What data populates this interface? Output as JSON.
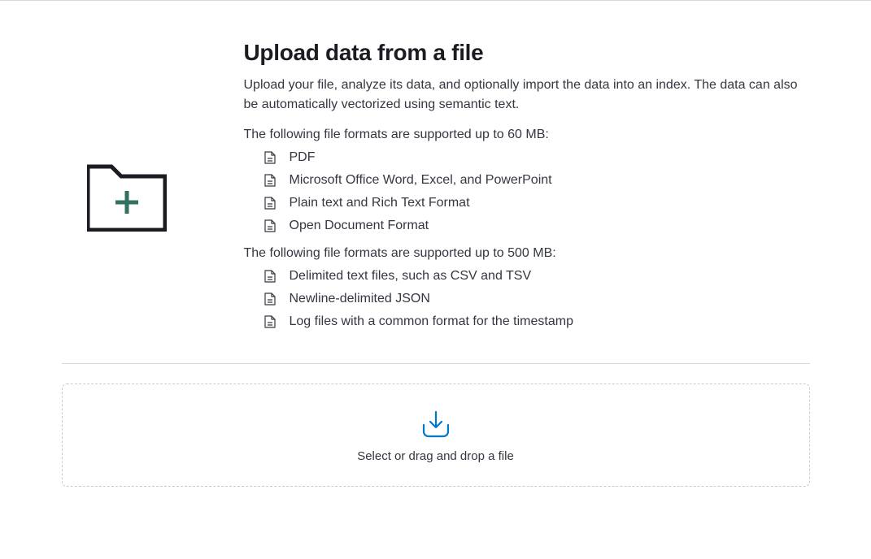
{
  "page": {
    "title": "Upload data from a file",
    "description": "Upload your file, analyze its data, and optionally import the data into an index. The data can also be automatically vectorized using semantic text."
  },
  "sections": {
    "small": {
      "intro": "The following file formats are supported up to 60 MB:",
      "items": [
        "PDF",
        "Microsoft Office Word, Excel, and PowerPoint",
        "Plain text and Rich Text Format",
        "Open Document Format"
      ]
    },
    "large": {
      "intro": "The following file formats are supported up to 500 MB:",
      "items": [
        "Delimited text files, such as CSV and TSV",
        "Newline-delimited JSON",
        "Log files with a common format for the timestamp"
      ]
    }
  },
  "dropzone": {
    "label": "Select or drag and drop a file"
  }
}
